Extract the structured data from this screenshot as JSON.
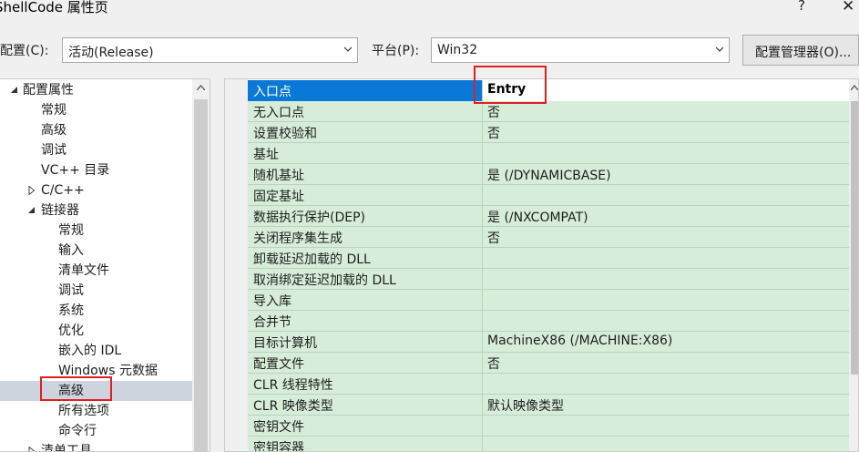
{
  "window": {
    "title": "ShellCode 属性页",
    "help": "?",
    "close": "✕"
  },
  "toolbar": {
    "config_label": "配置(C):",
    "config_value": "活动(Release)",
    "platform_label": "平台(P):",
    "platform_value": "Win32",
    "manager_button": "配置管理器(O)..."
  },
  "tree": [
    {
      "label": "配置属性",
      "level": 0,
      "state": "expanded"
    },
    {
      "label": "常规",
      "level": 1
    },
    {
      "label": "高级",
      "level": 1
    },
    {
      "label": "调试",
      "level": 1
    },
    {
      "label": "VC++ 目录",
      "level": 1
    },
    {
      "label": "C/C++",
      "level": 1,
      "state": "collapsed"
    },
    {
      "label": "链接器",
      "level": 1,
      "state": "expanded"
    },
    {
      "label": "常规",
      "level": 2
    },
    {
      "label": "输入",
      "level": 2
    },
    {
      "label": "清单文件",
      "level": 2
    },
    {
      "label": "调试",
      "level": 2
    },
    {
      "label": "系统",
      "level": 2
    },
    {
      "label": "优化",
      "level": 2
    },
    {
      "label": "嵌入的 IDL",
      "level": 2
    },
    {
      "label": "Windows 元数据",
      "level": 2
    },
    {
      "label": "高级",
      "level": 2,
      "selected": true
    },
    {
      "label": "所有选项",
      "level": 2
    },
    {
      "label": "命令行",
      "level": 2
    },
    {
      "label": "清单工具",
      "level": 1,
      "state": "collapsed"
    }
  ],
  "properties": [
    {
      "name": "入口点",
      "value": "Entry",
      "selected": true
    },
    {
      "name": "无入口点",
      "value": "否"
    },
    {
      "name": "设置校验和",
      "value": "否"
    },
    {
      "name": "基址",
      "value": ""
    },
    {
      "name": "随机基址",
      "value": "是 (/DYNAMICBASE)"
    },
    {
      "name": "固定基址",
      "value": ""
    },
    {
      "name": "数据执行保护(DEP)",
      "value": "是 (/NXCOMPAT)"
    },
    {
      "name": "关闭程序集生成",
      "value": "否"
    },
    {
      "name": "卸载延迟加载的 DLL",
      "value": ""
    },
    {
      "name": "取消绑定延迟加载的 DLL",
      "value": ""
    },
    {
      "name": "导入库",
      "value": ""
    },
    {
      "name": "合并节",
      "value": ""
    },
    {
      "name": "目标计算机",
      "value": "MachineX86 (/MACHINE:X86)"
    },
    {
      "name": "配置文件",
      "value": "否"
    },
    {
      "name": "CLR 线程特性",
      "value": ""
    },
    {
      "name": "CLR 映像类型",
      "value": "默认映像类型"
    },
    {
      "name": "密钥文件",
      "value": ""
    },
    {
      "name": "密钥容器",
      "value": ""
    }
  ],
  "colors": {
    "row_bg": "#d7edd9",
    "selection_blue": "#0a78d7",
    "highlight_red": "#e02020",
    "tree_selected": "#cdd4dd"
  }
}
